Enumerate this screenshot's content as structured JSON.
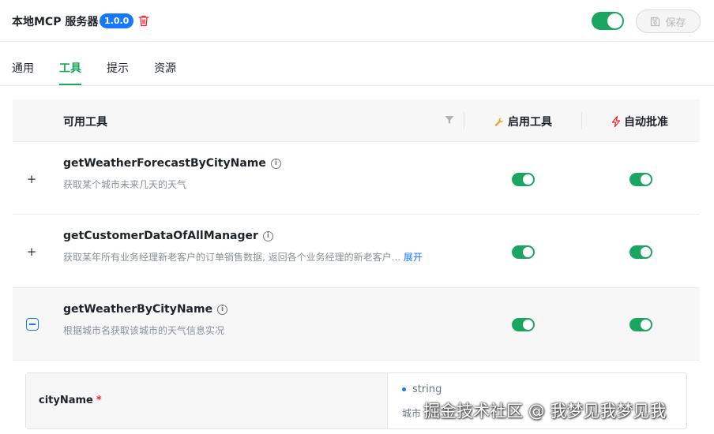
{
  "header": {
    "title": "本地MCP 服务器",
    "version": "1.0.0",
    "save_label": "保存"
  },
  "tabs": [
    {
      "label": "通用",
      "active": false
    },
    {
      "label": "工具",
      "active": true
    },
    {
      "label": "提示",
      "active": false
    },
    {
      "label": "资源",
      "active": false
    }
  ],
  "table": {
    "headers": {
      "tools": "可用工具",
      "enable": "启用工具",
      "auto_approve": "自动批准"
    },
    "rows": [
      {
        "name": "getWeatherForecastByCityName",
        "description": "获取某个城市未来几天的天气",
        "enabled": true,
        "auto_approve": true,
        "expanded": false
      },
      {
        "name": "getCustomerDataOfAllManager",
        "description": "获取某年所有业务经理新老客户的订单销售数据, 返回各个业务经理的新老客户...",
        "more_label": "展开",
        "enabled": true,
        "auto_approve": true,
        "expanded": false
      },
      {
        "name": "getWeatherByCityName",
        "description": "根据城市名获取该城市的天气信息实况",
        "enabled": true,
        "auto_approve": true,
        "expanded": true
      }
    ],
    "params": [
      {
        "name": "cityName",
        "required_mark": "*",
        "type": "string",
        "description": "城市"
      }
    ]
  },
  "watermark": "掘金技术社区 @ 我梦见我梦见我",
  "colors": {
    "accent": "#1aa561",
    "primary": "#1677ff",
    "danger": "#f5222d"
  }
}
